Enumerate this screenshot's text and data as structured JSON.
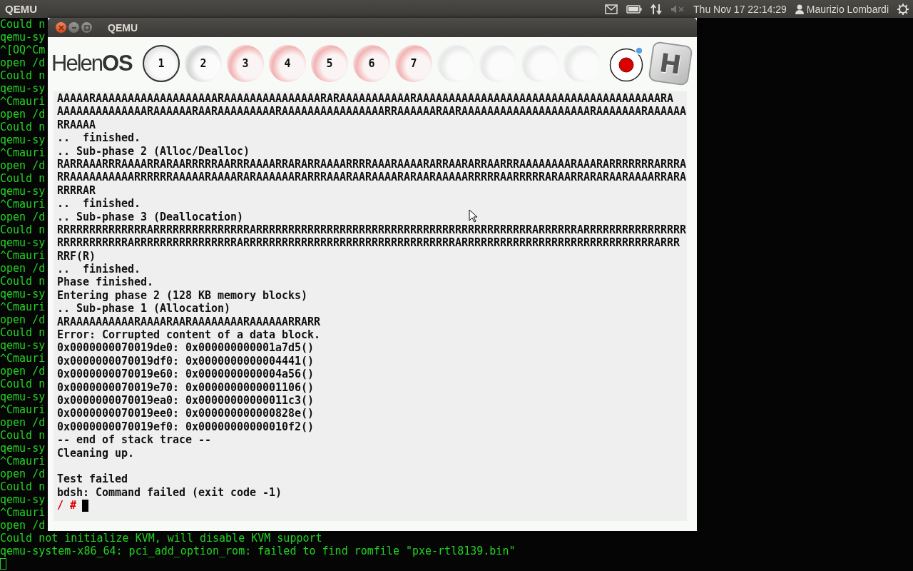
{
  "top_panel": {
    "app_name": "QEMU",
    "clock": "Thu Nov 17 22:14:29",
    "user": "Maurizio Lombardi"
  },
  "host_terminal": {
    "lines": [
      "Could n",
      "qemu-sy",
      "^[OQ^Cm",
      "open /d",
      "Could n",
      "qemu-sy",
      "^Cmauri",
      "open /d",
      "Could n",
      "qemu-sy",
      "^Cmauri",
      "open /d",
      "Could n",
      "qemu-sy",
      "^Cmauri",
      "open /d",
      "Could n",
      "qemu-sy",
      "^Cmauri",
      "open /d",
      "Could n",
      "qemu-sy",
      "^Cmauri",
      "open /d",
      "Could n",
      "qemu-sy",
      "^Cmauri",
      "open /d",
      "Could n",
      "qemu-sy",
      "^Cmauri",
      "open /d",
      "Could n",
      "qemu-sy",
      "^Cmauri",
      "open /d",
      "Could n",
      "qemu-sy",
      "^Cmauri",
      "open /d",
      "Could not initialize KVM, will disable KVM support",
      "qemu-system-x86_64: pci_add_option_rom: failed to find romfile \"pxe-rtl8139.bin\""
    ]
  },
  "window": {
    "title": "QEMU",
    "logo": "Helen**OS**",
    "consoles": [
      {
        "label": "1",
        "selected": true,
        "kind": "plain"
      },
      {
        "label": "2",
        "selected": false,
        "kind": "plain"
      },
      {
        "label": "3",
        "selected": false,
        "kind": "alert"
      },
      {
        "label": "4",
        "selected": false,
        "kind": "alert"
      },
      {
        "label": "5",
        "selected": false,
        "kind": "alert"
      },
      {
        "label": "6",
        "selected": false,
        "kind": "alert"
      },
      {
        "label": "7",
        "selected": false,
        "kind": "alert"
      },
      {
        "selected": false,
        "kind": "unused"
      },
      {
        "selected": false,
        "kind": "unused"
      },
      {
        "selected": false,
        "kind": "unused"
      },
      {
        "selected": false,
        "kind": "unused"
      }
    ],
    "badge": "H",
    "console_lines": [
      {
        "kind": "text",
        "text": "AAAAARAAAAAAAAAAAAAAAAAAARAAAAAAAAAAAAAAARARAAAAAAAAAAARAAAAAAAAAAAAAAAAAAAAAAAAAAAAAAAAAAAAAARA"
      },
      {
        "kind": "text",
        "text": "AAAAAAAAAAAAAARAAAAAARAARAAAAAAAAARAAAAAAAAAAAAAAAARRAAAAAARAARAAAAAAAAAAAAAAAAAAAARAAAAAAARAAAAAA"
      },
      {
        "kind": "text",
        "text": "RRAAAA"
      },
      {
        "kind": "text",
        "text": "..  finished."
      },
      {
        "kind": "text",
        "text": ".. Sub-phase 2 (Alloc/Dealloc)"
      },
      {
        "kind": "text",
        "text": "RARRAAARRRAAAARRARAARRRRRAARRRAAAARRARARRAAAARRRRAAARAAAARARRAARARRAARRRAAAAAAAARAAARARRRRRRRARRRA"
      },
      {
        "kind": "text",
        "text": "RRAAAAAAAAAARRRRRRAAAAARAAAARARAAAAAARARRRAAARAARAAAARARAARAAAAARRRRRAARRRRRARAARRARARAARAAAARRARA"
      },
      {
        "kind": "text",
        "text": "RRRRAR"
      },
      {
        "kind": "text",
        "text": "..  finished."
      },
      {
        "kind": "text",
        "text": ".. Sub-phase 3 (Deallocation)"
      },
      {
        "kind": "text",
        "text": "RRRRRRRRRRRRRRARRRRRRRRRRRRRRRARRRRRRRRRRRRRRRRRRRRRRRRRRRRRRRRRRRRRRRRRRRARRRRRRARRRRRRRRRRRRRRRR"
      },
      {
        "kind": "text",
        "text": "RRRRRRRRRRRARRRRRRRRRRRRRRRRARRRRRRRRRRRRRRRRRRRRRRRRRRRRRRRRRARRRRRRRRRRRRRRRRRRRRRRRRRRRRRRARRR"
      },
      {
        "kind": "text",
        "text": "RRF(R)"
      },
      {
        "kind": "text",
        "text": "..  finished."
      },
      {
        "kind": "text",
        "text": "Phase finished."
      },
      {
        "kind": "text",
        "text": "Entering phase 2 (128 KB memory blocks)"
      },
      {
        "kind": "text",
        "text": ".. Sub-phase 1 (Allocation)"
      },
      {
        "kind": "text",
        "text": "ARAAAAAAAAAARAAAARAARAAAAAAAARAAAAAARRARR"
      },
      {
        "kind": "text",
        "text": "Error: Corrupted content of a data block."
      },
      {
        "kind": "text",
        "text": "0x0000000070019de0: 0x000000000001a7d5()"
      },
      {
        "kind": "text",
        "text": "0x0000000070019df0: 0x0000000000004441()"
      },
      {
        "kind": "text",
        "text": "0x0000000070019e60: 0x0000000000004a56()"
      },
      {
        "kind": "text",
        "text": "0x0000000070019e70: 0x0000000000001106()"
      },
      {
        "kind": "text",
        "text": "0x0000000070019ea0: 0x00000000000011c3()"
      },
      {
        "kind": "text",
        "text": "0x0000000070019ee0: 0x000000000000828e()"
      },
      {
        "kind": "text",
        "text": "0x0000000070019ef0: 0x00000000000010f2()"
      },
      {
        "kind": "text",
        "text": "-- end of stack trace --"
      },
      {
        "kind": "text",
        "text": "Cleaning up."
      },
      {
        "kind": "blank"
      },
      {
        "kind": "text",
        "text": "Test failed"
      },
      {
        "kind": "text",
        "text": "bdsh: Command failed (exit code -1)"
      }
    ],
    "prompt": "/ #"
  }
}
